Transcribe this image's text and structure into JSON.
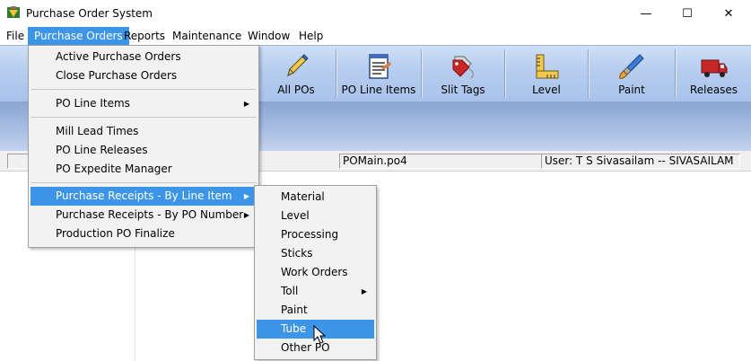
{
  "window": {
    "title": "Purchase Order System",
    "min_glyph": "—",
    "max_glyph": "☐",
    "close_glyph": "✕"
  },
  "menubar": {
    "items": [
      "File",
      "Purchase Orders",
      "Reports",
      "Maintenance",
      "Window",
      "Help"
    ],
    "active": "Purchase Orders"
  },
  "toolbar": {
    "buttons": [
      {
        "label": "All POs",
        "icon": "pencil-icon"
      },
      {
        "label": "PO Line Items",
        "icon": "notepad-icon"
      },
      {
        "label": "Slit Tags",
        "icon": "tags-icon"
      },
      {
        "label": "Level",
        "icon": "ruler-icon"
      },
      {
        "label": "Paint",
        "icon": "paintbrush-icon"
      },
      {
        "label": "Releases",
        "icon": "truck-icon"
      }
    ]
  },
  "status": {
    "form": "POMain.po4",
    "user": "User: T S Sivasailam -- SIVASAILAM"
  },
  "dropdown": {
    "items": [
      "Active Purchase Orders",
      "Close Purchase Orders",
      "PO Line Items",
      "Mill Lead Times",
      "PO Line Releases",
      "PO Expedite Manager",
      "Purchase Receipts - By Line Item",
      "Purchase Receipts - By PO Number",
      "Production PO Finalize"
    ],
    "highlighted": "Purchase Receipts - By Line Item",
    "submenu_arrow": "▶"
  },
  "submenu": {
    "items": [
      "Material",
      "Level",
      "Processing",
      "Sticks",
      "Work Orders",
      "Toll",
      "Paint",
      "Tube",
      "Other PO"
    ],
    "highlighted": "Tube"
  },
  "colors": {
    "highlight": "#3d95e8",
    "toolbar_bg": "#b7ceef"
  }
}
